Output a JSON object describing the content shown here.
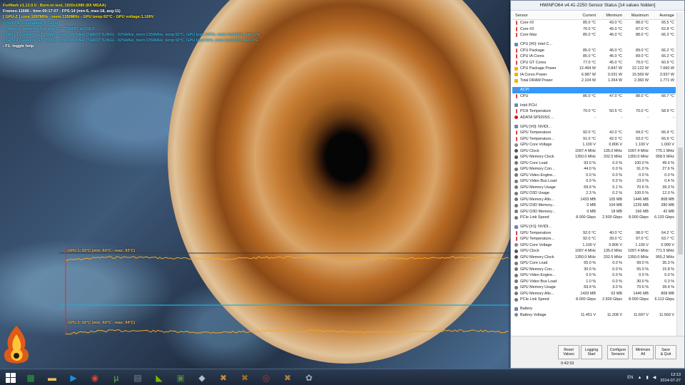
{
  "furmark": {
    "lines": [
      {
        "text": "FurMark v1.13.0.0 - Burn-in test, 1920x1080 (8X MSAA)",
        "cls": "fm-yellow"
      },
      {
        "text": "Frames:11686 - time:00:17:07 - FPS:14 (min:6, max:18, avg:11)",
        "cls": "fm-white"
      },
      {
        "text": "[ GPU-Z ] core:1097MHz - mem:1350MHz - GPU temp:92°C - GPU voltage:1.100V",
        "cls": "fm-yellow"
      },
      {
        "text": "> NVIDIA SLI enabled, 2 GPUs",
        "cls": "fm-cyan-b"
      },
      {
        "text": "> OpenGL renderer: GeForce GT 755M/PCIe/SSE2",
        "cls": "fm-cyan"
      },
      {
        "text": "> GPU 1 (GeForce GT 755M) - core:1097MHz (THROTTLING) - 92%MHz, mem:1350MHz, temp:92°C, GPU load:100%, mem load:68%, fan:-1%",
        "cls": "fm-cyan"
      },
      {
        "text": "> GPU 2 (GeForce GT 755M) - core:1097MHz (THROTTLING) - 92%MHz, mem:1350MHz, temp:92°C, GPU load:96%, mem load:68%, fan:-1%",
        "cls": "fm-cyan"
      },
      {
        "text": "- F1: toggle help",
        "cls": "fm-white"
      }
    ],
    "graph1_label": "GPU 1: 92°C (min: 60°C - max: 93°C)",
    "graph2_label": "GPU 2: 92°C (min: 60°C - max: 94°C)"
  },
  "hwinfo": {
    "title": "HWiNFO64 v4.41-2250 Sensor Status [14 values hidden]",
    "columns": {
      "sensor": "Sensor",
      "current": "Current",
      "minimum": "Minimum",
      "maximum": "Maximum",
      "average": "Average"
    },
    "rows": [
      {
        "type": "data",
        "icon": "temp",
        "name": "Core #2",
        "cur": "85.0 °C",
        "min": "43.0 °C",
        "max": "88.0 °C",
        "avg": "65.5 °C"
      },
      {
        "type": "data",
        "icon": "temp",
        "name": "Core #3",
        "cur": "76.0 °C",
        "min": "45.0 °C",
        "max": "87.0 °C",
        "avg": "62.8 °C"
      },
      {
        "type": "data",
        "icon": "temp",
        "name": "Core Max",
        "cur": "85.0 °C",
        "min": "46.0 °C",
        "max": "88.0 °C",
        "avg": "66.3 °C"
      },
      {
        "type": "spacer"
      },
      {
        "type": "group",
        "icon": "group",
        "name": "CPU [#0]: Intel C..."
      },
      {
        "type": "data",
        "icon": "temp",
        "name": "CPU Package",
        "cur": "85.0 °C",
        "min": "46.0 °C",
        "max": "89.0 °C",
        "avg": "66.2 °C"
      },
      {
        "type": "data",
        "icon": "temp",
        "name": "CPU IA Cores",
        "cur": "85.0 °C",
        "min": "46.0 °C",
        "max": "89.0 °C",
        "avg": "66.2 °C"
      },
      {
        "type": "data",
        "icon": "temp",
        "name": "CPU GT Cores",
        "cur": "77.0 °C",
        "min": "45.0 °C",
        "max": "79.0 °C",
        "avg": "60.9 °C"
      },
      {
        "type": "data",
        "icon": "power",
        "name": "CPU Package Power",
        "cur": "12.494 W",
        "min": "0.847 W",
        "max": "22.122 W",
        "avg": "7.660 W"
      },
      {
        "type": "data",
        "icon": "power",
        "name": "IA Cores Power",
        "cur": "6.987 W",
        "min": "0.031 W",
        "max": "15.569 W",
        "avg": "3.937 W"
      },
      {
        "type": "data",
        "icon": "power",
        "name": "Total DRAM Power",
        "cur": "2.104 W",
        "min": "1.264 W",
        "max": "2.360 W",
        "avg": "1.771 W"
      },
      {
        "type": "spacer"
      },
      {
        "type": "group",
        "icon": "group",
        "name": "ACPI",
        "selected": true
      },
      {
        "type": "data",
        "icon": "temp",
        "name": "CPU",
        "cur": "86.0 °C",
        "min": "47.0 °C",
        "max": "88.0 °C",
        "avg": "66.7 °C"
      },
      {
        "type": "spacer"
      },
      {
        "type": "group",
        "icon": "group",
        "name": "Intel PCH"
      },
      {
        "type": "data",
        "icon": "temp",
        "name": "PCH Temperature",
        "cur": "70.0 °C",
        "min": "50.5 °C",
        "max": "70.0 °C",
        "avg": "58.9 °C"
      },
      {
        "type": "data",
        "icon": "err",
        "name": "ADATA SP920SS ...",
        "cur": "-",
        "min": "-",
        "max": "-",
        "avg": "-"
      },
      {
        "type": "spacer"
      },
      {
        "type": "group",
        "icon": "group",
        "name": "GPU [#0]: NVIDI..."
      },
      {
        "type": "data",
        "icon": "temp",
        "name": "GPU Temperature",
        "cur": "92.0 °C",
        "min": "42.0 °C",
        "max": "94.0 °C",
        "avg": "66.4 °C"
      },
      {
        "type": "data",
        "icon": "temp",
        "name": "GPU Temperature...",
        "cur": "91.0 °C",
        "min": "42.0 °C",
        "max": "93.0 °C",
        "avg": "65.9 °C"
      },
      {
        "type": "data",
        "icon": "volt",
        "name": "GPU Core Voltage",
        "cur": "1.100 V",
        "min": "0.806 V",
        "max": "1.100 V",
        "avg": "1.000 V"
      },
      {
        "type": "data",
        "icon": "clock",
        "name": "GPU Clock",
        "cur": "1097.4 MHz",
        "min": "135.0 MHz",
        "max": "1097.4 MHz",
        "avg": "775.1 MHz"
      },
      {
        "type": "data",
        "icon": "clock",
        "name": "GPU Memory Clock",
        "cur": "1350.0 MHz",
        "min": "202.5 MHz",
        "max": "1350.0 MHz",
        "avg": "958.5 MHz"
      },
      {
        "type": "data",
        "icon": "misc",
        "name": "GPU Core Load",
        "cur": "93.0 %",
        "min": "0.0 %",
        "max": "100.0 %",
        "avg": "49.0 %"
      },
      {
        "type": "data",
        "icon": "misc",
        "name": "GPU Memory Con...",
        "cur": "44.0 %",
        "min": "0.0 %",
        "max": "91.0 %",
        "avg": "27.6 %"
      },
      {
        "type": "data",
        "icon": "misc",
        "name": "GPU Video Engine...",
        "cur": "0.0 %",
        "min": "0.0 %",
        "max": "0.0 %",
        "avg": "0.0 %"
      },
      {
        "type": "data",
        "icon": "misc",
        "name": "GPU Video Bus Load",
        "cur": "0.0 %",
        "min": "0.0 %",
        "max": "23.0 %",
        "avg": "0.4 %"
      },
      {
        "type": "data",
        "icon": "misc",
        "name": "GPU Memory Usage",
        "cur": "69.9 %",
        "min": "5.1 %",
        "max": "70.6 %",
        "avg": "39.3 %"
      },
      {
        "type": "data",
        "icon": "misc",
        "name": "GPU D3D Usage",
        "cur": "2.3 %",
        "min": "0.2 %",
        "max": "100.0 %",
        "avg": "12.0 %"
      },
      {
        "type": "data",
        "icon": "misc",
        "name": "GPU Memory Allo...",
        "cur": "1433 MB",
        "min": "105 MB",
        "max": "1446 MB",
        "avg": "808 MB"
      },
      {
        "type": "data",
        "icon": "misc",
        "name": "GPU D3D Memory...",
        "cur": "0 MB",
        "min": "104 MB",
        "max": "1226 MB",
        "avg": "280 MB"
      },
      {
        "type": "data",
        "icon": "misc",
        "name": "GPU D3D Memory...",
        "cur": "0 MB",
        "min": "18 MB",
        "max": "166 MB",
        "avg": "42 MB"
      },
      {
        "type": "data",
        "icon": "misc",
        "name": "PCIe Link Speed",
        "cur": "8.000 Gbps",
        "min": "2.500 Gbps",
        "max": "8.000 Gbps",
        "avg": "6.133 Gbps"
      },
      {
        "type": "spacer"
      },
      {
        "type": "group",
        "icon": "group",
        "name": "GPU [#1]: NVIDI..."
      },
      {
        "type": "data",
        "icon": "temp",
        "name": "GPU Temperature",
        "cur": "92.0 °C",
        "min": "40.0 °C",
        "max": "98.0 °C",
        "avg": "64.2 °C"
      },
      {
        "type": "data",
        "icon": "temp",
        "name": "GPU Temperature...",
        "cur": "92.0 °C",
        "min": "39.0 °C",
        "max": "97.0 °C",
        "avg": "63.7 °C"
      },
      {
        "type": "data",
        "icon": "volt",
        "name": "GPU Core Voltage",
        "cur": "1.100 V",
        "min": "0.806 V",
        "max": "1.100 V",
        "avg": "0.999 V"
      },
      {
        "type": "data",
        "icon": "clock",
        "name": "GPU Clock",
        "cur": "1097.4 MHz",
        "min": "135.0 MHz",
        "max": "1097.4 MHz",
        "avg": "771.5 MHz"
      },
      {
        "type": "data",
        "icon": "clock",
        "name": "GPU Memory Clock",
        "cur": "1350.0 MHz",
        "min": "202.5 MHz",
        "max": "1350.0 MHz",
        "avg": "955.2 MHz"
      },
      {
        "type": "data",
        "icon": "misc",
        "name": "GPU Core Load",
        "cur": "65.0 %",
        "min": "0.0 %",
        "max": "99.0 %",
        "avg": "35.3 %"
      },
      {
        "type": "data",
        "icon": "misc",
        "name": "GPU Memory Con...",
        "cur": "30.0 %",
        "min": "0.0 %",
        "max": "55.0 %",
        "avg": "15.8 %"
      },
      {
        "type": "data",
        "icon": "misc",
        "name": "GPU Video Engine...",
        "cur": "0.0 %",
        "min": "0.0 %",
        "max": "0.0 %",
        "avg": "0.0 %"
      },
      {
        "type": "data",
        "icon": "misc",
        "name": "GPU Video Bus Load",
        "cur": "1.0 %",
        "min": "0.0 %",
        "max": "30.0 %",
        "avg": "0.3 %"
      },
      {
        "type": "data",
        "icon": "misc",
        "name": "GPU Memory Usage",
        "cur": "69.9 %",
        "min": "3.0 %",
        "max": "70.6 %",
        "avg": "39.4 %"
      },
      {
        "type": "data",
        "icon": "misc",
        "name": "GPU Memory Allo...",
        "cur": "1433 MB",
        "min": "62 MB",
        "max": "1446 MB",
        "avg": "808 MB"
      },
      {
        "type": "data",
        "icon": "misc",
        "name": "PCIe Link Speed",
        "cur": "8.000 Gbps",
        "min": "2.500 Gbps",
        "max": "8.000 Gbps",
        "avg": "6.113 Gbps"
      },
      {
        "type": "spacer"
      },
      {
        "type": "group",
        "icon": "group",
        "name": "Battery"
      },
      {
        "type": "data",
        "icon": "volt",
        "name": "Battery Voltage",
        "cur": "11.451 V",
        "min": "11.208 V",
        "max": "11.697 V",
        "avg": "11.569 V"
      }
    ],
    "buttons": [
      {
        "id": "reset-values",
        "line1": "Reset",
        "line2": "Values"
      },
      {
        "id": "logging-start",
        "line1": "Logging",
        "line2": "Start"
      },
      {
        "id": "configure-sensors",
        "line1": "Configure",
        "line2": "Sensors"
      },
      {
        "id": "minimize-all",
        "line1": "Minimize",
        "line2": "All"
      },
      {
        "id": "save-quit",
        "line1": "Save",
        "line2": "& Quit"
      }
    ],
    "timer": "0:42:52"
  },
  "taskbar": {
    "language": "EN",
    "time": "13:13",
    "date": "2014-07-27",
    "apps": [
      {
        "name": "file-manager-icon",
        "color": "#2ea043",
        "glyph": "▦"
      },
      {
        "name": "folder-icon",
        "color": "#e8c25a",
        "glyph": "▬"
      },
      {
        "name": "media-player-icon",
        "color": "#1b8fe0",
        "glyph": "▶"
      },
      {
        "name": "chrome-icon",
        "color": "#e2452f",
        "glyph": "◉"
      },
      {
        "name": "utorrent-icon",
        "color": "#6bb44a",
        "glyph": "µ"
      },
      {
        "name": "calculator-icon",
        "color": "#7a8796",
        "glyph": "▤"
      },
      {
        "name": "nvidia-icon",
        "color": "#76b900",
        "glyph": "◣"
      },
      {
        "name": "terminal-icon",
        "color": "#4c8a3c",
        "glyph": "▣"
      },
      {
        "name": "notes-icon",
        "color": "#aebfd2",
        "glyph": "◆"
      },
      {
        "name": "game-icon",
        "color": "#c88a3a",
        "glyph": "✖"
      },
      {
        "name": "mcpu-icon",
        "color": "#a36a2a",
        "glyph": "✖"
      },
      {
        "name": "furmark-icon",
        "color": "#c8301a",
        "glyph": "◎"
      },
      {
        "name": "game2-icon",
        "color": "#b27a3e",
        "glyph": "✖"
      },
      {
        "name": "hwinfo-icon",
        "color": "#9aa8b8",
        "glyph": "✿"
      }
    ]
  }
}
